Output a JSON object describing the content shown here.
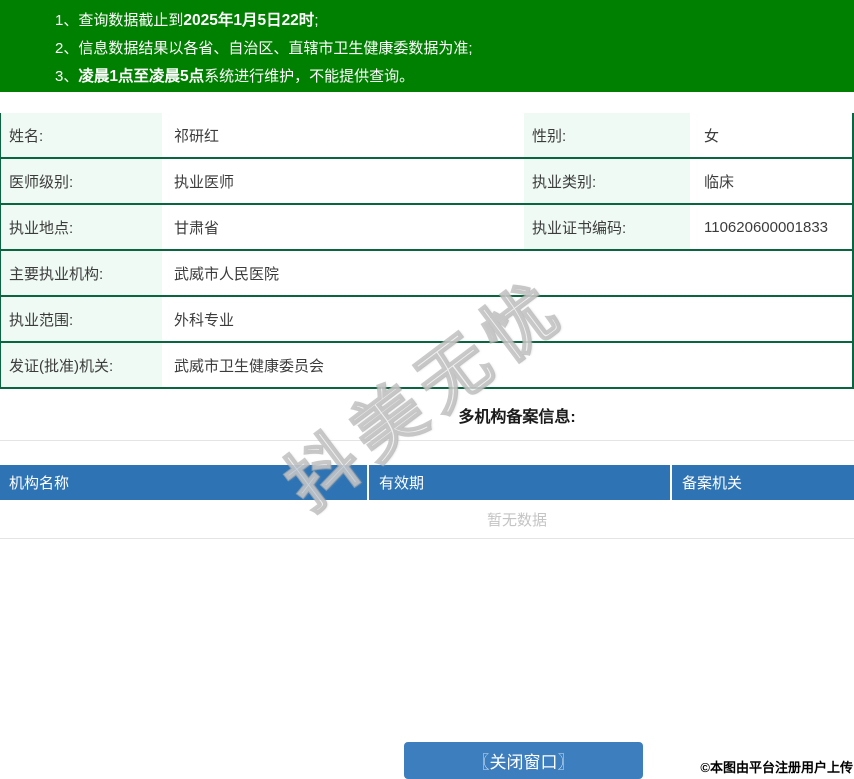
{
  "notice": {
    "bg_color": "#008000",
    "lines": [
      {
        "pre": "1、查询数据截止到",
        "bold": "2025年1月5日22时",
        "post": ";"
      },
      {
        "pre": "2、信息数据结果以各省、自治区、直辖市卫生健康委数据为准;",
        "bold": "",
        "post": ""
      },
      {
        "pre": "3、",
        "bold": "凌晨1点至凌晨5点",
        "post": "系统进行维护，不能提供查询。"
      }
    ]
  },
  "info_table": {
    "label_bg_color": "#eefaf3",
    "border_color": "#0a6640",
    "rows": [
      {
        "label1": "姓名:",
        "value1": "祁研红",
        "label2": "性别:",
        "value2": "女"
      },
      {
        "label1": "医师级别:",
        "value1": "执业医师",
        "label2": "执业类别:",
        "value2": "临床"
      },
      {
        "label1": "执业地点:",
        "value1": "甘肃省",
        "label2": "执业证书编码:",
        "value2": "110620600001833"
      },
      {
        "label1": "主要执业机构:",
        "value1": "武威市人民医院"
      },
      {
        "label1": "执业范围:",
        "value1": "外科专业"
      },
      {
        "label1": "发证(批准)机关:",
        "value1": "武威市卫生健康委员会"
      }
    ]
  },
  "section": {
    "title": "多机构备案信息:"
  },
  "filing_table": {
    "header_bg_color": "#2e74b5",
    "headers": [
      "机构名称",
      "有效期",
      "备案机关"
    ],
    "empty_text": "暂无数据"
  },
  "watermark": {
    "text": "抖美无忧"
  },
  "footer": {
    "close_button_label": "〖关闭窗口〗",
    "button_color": "#3d7ebf",
    "attribution": "©本图由平台注册用户上传"
  }
}
